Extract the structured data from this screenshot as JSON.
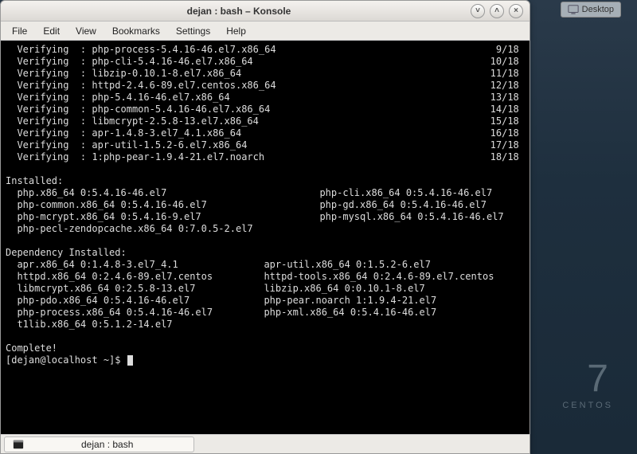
{
  "desktop_button": "Desktop",
  "centos": {
    "num": "7",
    "label": "CENTOS"
  },
  "window": {
    "title": "dejan : bash – Konsole",
    "menus": [
      "File",
      "Edit",
      "View",
      "Bookmarks",
      "Settings",
      "Help"
    ],
    "tab_label": "dejan : bash",
    "prompt": "[dejan@localhost ~]$ "
  },
  "terminal": {
    "verifying": [
      {
        "pkg": "php-process-5.4.16-46.el7.x86_64",
        "idx": "9/18"
      },
      {
        "pkg": "php-cli-5.4.16-46.el7.x86_64",
        "idx": "10/18"
      },
      {
        "pkg": "libzip-0.10.1-8.el7.x86_64",
        "idx": "11/18"
      },
      {
        "pkg": "httpd-2.4.6-89.el7.centos.x86_64",
        "idx": "12/18"
      },
      {
        "pkg": "php-5.4.16-46.el7.x86_64",
        "idx": "13/18"
      },
      {
        "pkg": "php-common-5.4.16-46.el7.x86_64",
        "idx": "14/18"
      },
      {
        "pkg": "libmcrypt-2.5.8-13.el7.x86_64",
        "idx": "15/18"
      },
      {
        "pkg": "apr-1.4.8-3.el7_4.1.x86_64",
        "idx": "16/18"
      },
      {
        "pkg": "apr-util-1.5.2-6.el7.x86_64",
        "idx": "17/18"
      },
      {
        "pkg": "1:php-pear-1.9.4-21.el7.noarch",
        "idx": "18/18"
      }
    ],
    "installed_header": "Installed:",
    "installed_col1": [
      "php.x86_64 0:5.4.16-46.el7",
      "php-common.x86_64 0:5.4.16-46.el7",
      "php-mcrypt.x86_64 0:5.4.16-9.el7",
      "php-pecl-zendopcache.x86_64 0:7.0.5-2.el7"
    ],
    "installed_col2": [
      "php-cli.x86_64 0:5.4.16-46.el7",
      "php-gd.x86_64 0:5.4.16-46.el7",
      "php-mysql.x86_64 0:5.4.16-46.el7",
      ""
    ],
    "dep_header": "Dependency Installed:",
    "dep_col1": [
      "apr.x86_64 0:1.4.8-3.el7_4.1",
      "httpd.x86_64 0:2.4.6-89.el7.centos",
      "libmcrypt.x86_64 0:2.5.8-13.el7",
      "php-pdo.x86_64 0:5.4.16-46.el7",
      "php-process.x86_64 0:5.4.16-46.el7",
      "t1lib.x86_64 0:5.1.2-14.el7"
    ],
    "dep_col2": [
      "apr-util.x86_64 0:1.5.2-6.el7",
      "httpd-tools.x86_64 0:2.4.6-89.el7.centos",
      "libzip.x86_64 0:0.10.1-8.el7",
      "php-pear.noarch 1:1.9.4-21.el7",
      "php-xml.x86_64 0:5.4.16-46.el7",
      ""
    ],
    "complete": "Complete!"
  }
}
